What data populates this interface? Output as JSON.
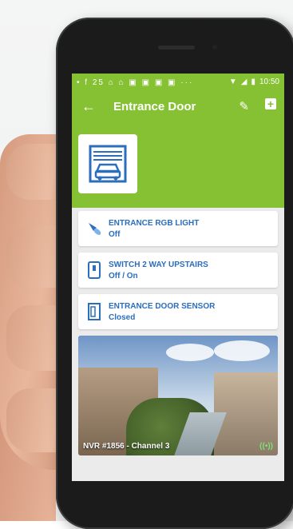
{
  "status_bar": {
    "time": "10:50",
    "left_icons_text": "• f 25 ⌂ ⌂ ▣ ▣ ▣ ▣ ···"
  },
  "app_bar": {
    "title": "Entrance Door",
    "back_icon": "arrow-left-icon",
    "edit_icon": "pencil-icon",
    "add_icon": "plus-square-icon"
  },
  "colors": {
    "accent": "#86c133",
    "text_blue": "#2a6ebd",
    "live_indicator": "#7ee07a"
  },
  "hero": {
    "icon": "garage-car-icon"
  },
  "devices": [
    {
      "name": "ENTRANCE RGB LIGHT",
      "state": "Off",
      "icon": "bulb-icon"
    },
    {
      "name": "SWITCH 2 WAY UPSTAIRS",
      "state": "Off / On",
      "icon": "switch-icon"
    },
    {
      "name": "ENTRANCE DOOR SENSOR",
      "state": "Closed",
      "icon": "door-sensor-icon"
    }
  ],
  "camera": {
    "label": "NVR #1856 - Channel 3",
    "live_icon": "broadcast-icon"
  }
}
